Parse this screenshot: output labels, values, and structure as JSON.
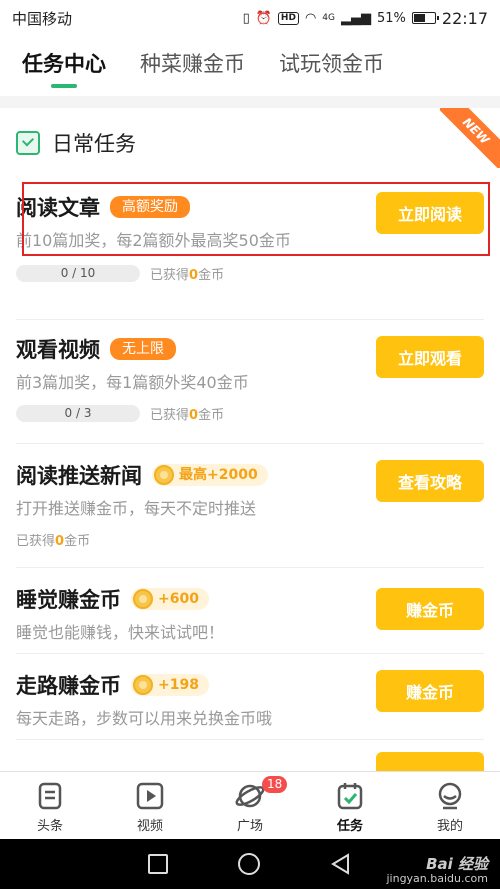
{
  "status": {
    "carrier": "中国移动",
    "network": "4G",
    "battery": "51%",
    "time": "22:17"
  },
  "tabs": [
    {
      "label": "任务中心",
      "active": true
    },
    {
      "label": "种菜赚金币",
      "active": false
    },
    {
      "label": "试玩领金币",
      "active": false
    }
  ],
  "section": {
    "title": "日常任务",
    "ribbon": "NEW"
  },
  "tasks": [
    {
      "name": "阅读文章",
      "tag": "高额奖励",
      "desc": "前10篇加奖，每2篇额外最高奖50金币",
      "progress": "0 / 10",
      "earned_prefix": "已获得",
      "earned_num": "0",
      "earned_suffix": "金币",
      "button": "立即阅读"
    },
    {
      "name": "观看视频",
      "tag": "无上限",
      "desc": "前3篇加奖，每1篇额外奖40金币",
      "progress": "0 / 3",
      "earned_prefix": "已获得",
      "earned_num": "0",
      "earned_suffix": "金币",
      "button": "立即观看"
    },
    {
      "name": "阅读推送新闻",
      "coin_tag": "最高+2000",
      "desc": "打开推送赚金币，每天不定时推送",
      "earned_prefix": "已获得",
      "earned_num": "0",
      "earned_suffix": "金币",
      "button": "查看攻略"
    },
    {
      "name": "睡觉赚金币",
      "coin_tag": "+600",
      "desc": "睡觉也能赚钱，快来试试吧！",
      "button": "赚金币"
    },
    {
      "name": "走路赚金币",
      "coin_tag": "+198",
      "desc": "每天走路，步数可以用来兑换金币哦",
      "button": "赚金币"
    }
  ],
  "bottom_nav": [
    {
      "label": "头条",
      "icon": "news-icon"
    },
    {
      "label": "视频",
      "icon": "video-icon"
    },
    {
      "label": "广场",
      "icon": "plaza-icon",
      "badge": "18"
    },
    {
      "label": "任务",
      "icon": "task-icon",
      "active": true
    },
    {
      "label": "我的",
      "icon": "profile-icon"
    }
  ],
  "watermark": {
    "brand": "Bai 经验",
    "url": "jingyan.baidu.com"
  },
  "colors": {
    "accent_green": "#2bb673",
    "button_yellow": "#ffc20e",
    "tag_orange": "#ff8a1f",
    "highlight_red": "#e02424"
  }
}
